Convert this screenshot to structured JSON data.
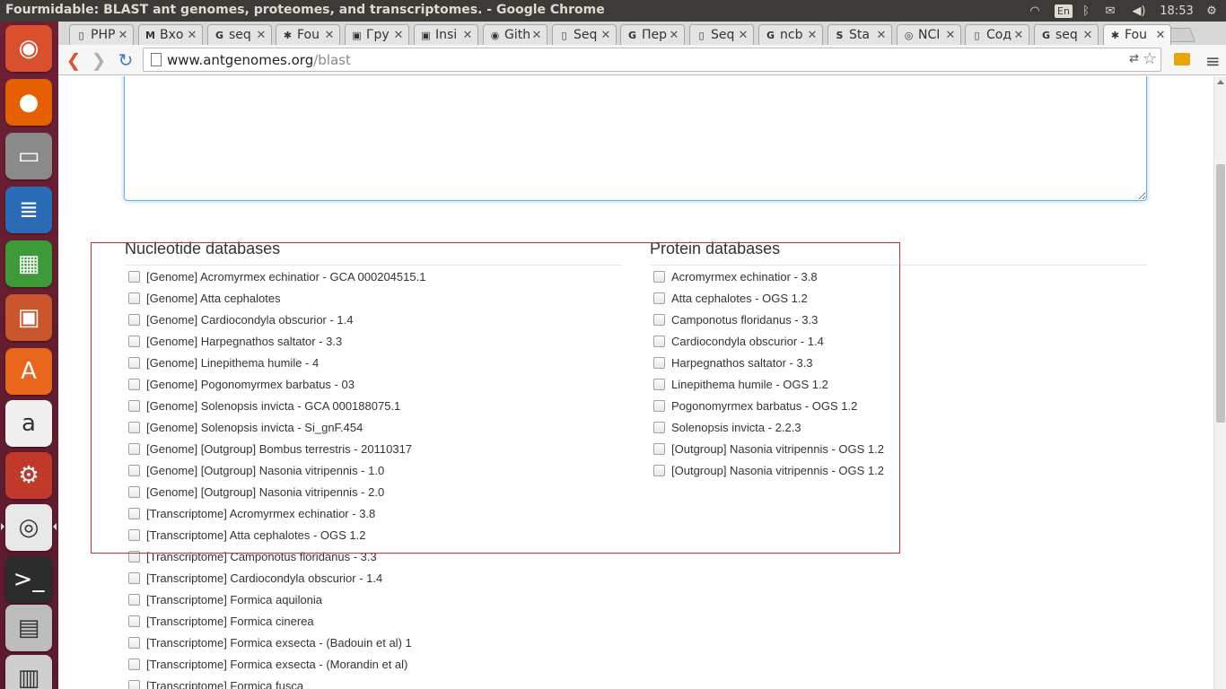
{
  "window": {
    "title": "Fourmidable: BLAST ant genomes, proteomes, and transcriptomes. - Google Chrome"
  },
  "tray": {
    "wifi_icon": "wifi-icon",
    "keyboard_lang": "En",
    "bluetooth_icon": "bluetooth-icon",
    "mail_icon": "mail-icon",
    "volume_icon": "volume-icon",
    "clock": "18:53",
    "gear_icon": "gear-icon"
  },
  "launcher": {
    "apps": [
      {
        "name": "ubuntu-dash-icon",
        "color": "#d9502e",
        "glyph": "◉"
      },
      {
        "name": "firefox-icon",
        "color": "#e66000",
        "glyph": "●"
      },
      {
        "name": "files-icon",
        "color": "#8a8a8a",
        "glyph": "▭"
      },
      {
        "name": "libreoffice-writer-icon",
        "color": "#2a6bb5",
        "glyph": "≣"
      },
      {
        "name": "libreoffice-calc-icon",
        "color": "#3e9a38",
        "glyph": "▦"
      },
      {
        "name": "libreoffice-impress-icon",
        "color": "#c9562d",
        "glyph": "▣"
      },
      {
        "name": "software-center-icon",
        "color": "#e8671d",
        "glyph": "A"
      },
      {
        "name": "amazon-icon",
        "color": "#f0f0f0",
        "glyph": "a"
      },
      {
        "name": "system-settings-icon",
        "color": "#c0392b",
        "glyph": "⚙"
      },
      {
        "name": "chrome-icon",
        "color": "#e8e8e8",
        "glyph": "◎"
      },
      {
        "name": "terminal-icon",
        "color": "#2c2c2c",
        "glyph": ">_"
      },
      {
        "name": "workspace-switcher-icon",
        "color": "#bdbdbd",
        "glyph": "▤"
      },
      {
        "name": "removable-drive-icon",
        "color": "#cfcfcf",
        "glyph": "▥"
      }
    ]
  },
  "tabs": [
    {
      "title": "PHP",
      "favicon": "page-icon",
      "fav": "▯"
    },
    {
      "title": "Вхо",
      "favicon": "gmail-icon",
      "fav": "M"
    },
    {
      "title": "seq",
      "favicon": "google-icon",
      "fav": "G"
    },
    {
      "title": "Fou",
      "favicon": "ant-icon",
      "fav": "✱"
    },
    {
      "title": "Гру",
      "favicon": "groups-icon",
      "fav": "▣"
    },
    {
      "title": "Insi",
      "favicon": "groups-icon",
      "fav": "▣"
    },
    {
      "title": "Gith",
      "favicon": "github-icon",
      "fav": "◉"
    },
    {
      "title": "Seq",
      "favicon": "page-icon",
      "fav": "▯"
    },
    {
      "title": "Пер",
      "favicon": "translate-icon",
      "fav": "G"
    },
    {
      "title": "Seq",
      "favicon": "page-icon",
      "fav": "▯"
    },
    {
      "title": "ncb",
      "favicon": "google-icon",
      "fav": "G"
    },
    {
      "title": "Sta",
      "favicon": "stack-icon",
      "fav": "S"
    },
    {
      "title": "NCI",
      "favicon": "ncbi-icon",
      "fav": "◎"
    },
    {
      "title": "Coд",
      "favicon": "page-icon",
      "fav": "▯"
    },
    {
      "title": "seq",
      "favicon": "google-icon",
      "fav": "G"
    },
    {
      "title": "Fou",
      "favicon": "ant-icon",
      "fav": "✱"
    }
  ],
  "active_tab_index": 15,
  "toolbar": {
    "url_host": "www.antgenomes.org",
    "url_path": "/blast"
  },
  "nucleotide": {
    "heading": "Nucleotide databases",
    "items": [
      "[Genome] Acromyrmex echinatior - GCA 000204515.1",
      "[Genome] Atta cephalotes",
      "[Genome] Cardiocondyla obscurior - 1.4",
      "[Genome] Harpegnathos saltator - 3.3",
      "[Genome] Linepithema humile - 4",
      "[Genome] Pogonomyrmex barbatus - 03",
      "[Genome] Solenopsis invicta - GCA 000188075.1",
      "[Genome] Solenopsis invicta - Si_gnF.454",
      "[Genome] [Outgroup] Bombus terrestris - 20110317",
      "[Genome] [Outgroup] Nasonia vitripennis - 1.0",
      "[Genome] [Outgroup] Nasonia vitripennis - 2.0",
      "[Transcriptome] Acromyrmex echinatior - 3.8",
      "[Transcriptome] Atta cephalotes - OGS 1.2",
      "[Transcriptome] Camponotus floridanus - 3.3",
      "[Transcriptome] Cardiocondyla obscurior - 1.4",
      "[Transcriptome] Formica aquilonia",
      "[Transcriptome] Formica cinerea",
      "[Transcriptome] Formica exsecta - (Badouin et al) 1",
      "[Transcriptome] Formica exsecta - (Morandin et al)",
      "[Transcriptome] Formica fusca"
    ]
  },
  "protein": {
    "heading": "Protein databases",
    "items": [
      "Acromyrmex echinatior - 3.8",
      "Atta cephalotes - OGS 1.2",
      "Camponotus floridanus - 3.3",
      "Cardiocondyla obscurior - 1.4",
      "Harpegnathos saltator - 3.3",
      "Linepithema humile - OGS 1.2",
      "Pogonomyrmex barbatus - OGS 1.2",
      "Solenopsis invicta - 2.2.3",
      "[Outgroup] Nasonia vitripennis - OGS 1.2",
      "[Outgroup] Nasonia vitripennis - OGS 1.2"
    ]
  },
  "colors": {
    "highlight_box": "#d32f2f",
    "textarea_focus": "#66afe9",
    "launcher_bg": "#6e2033"
  }
}
